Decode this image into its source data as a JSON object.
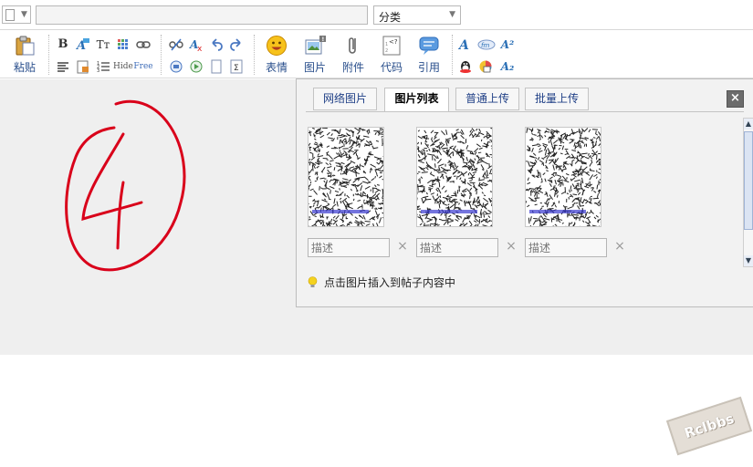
{
  "topbar": {
    "title_value": "",
    "category_value": "分类"
  },
  "toolbar": {
    "paste_label": "粘贴",
    "hide_label": "Hide",
    "free_label": "Free",
    "emoticon_label": "表情",
    "image_label": "图片",
    "attachment_label": "附件",
    "code_label": "代码",
    "quote_label": "引用"
  },
  "image_panel": {
    "tabs": [
      {
        "label": "网络图片",
        "active": false
      },
      {
        "label": "图片列表",
        "active": true
      },
      {
        "label": "普通上传",
        "active": false
      },
      {
        "label": "批量上传",
        "active": false
      }
    ],
    "close_label": "×",
    "images": [
      {
        "description_placeholder": "描述",
        "delete_label": "×"
      },
      {
        "description_placeholder": "描述",
        "delete_label": "×"
      },
      {
        "description_placeholder": "描述",
        "delete_label": "×"
      }
    ],
    "hint": "点击图片插入到帖子内容中"
  },
  "watermark": "Rclbbs",
  "colors": {
    "editor_bg": "#efefef",
    "panel_bg": "#f2f2f2",
    "link_blue": "#1f3f86",
    "drawing_red": "#d9001a"
  },
  "icons": {
    "bold": "B",
    "font_size": "Tт",
    "superscript": "A²",
    "subscript": "A₂"
  }
}
